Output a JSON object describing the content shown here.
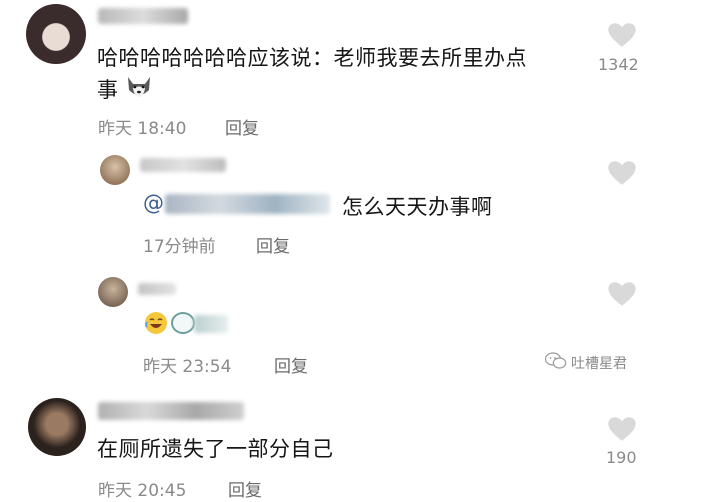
{
  "comments": [
    {
      "text_line1": "哈哈哈哈哈哈哈应该说：老师我要去所里办点",
      "text_line2": "事",
      "time": "昨天 18:40",
      "reply_label": "回复",
      "like_count": "1342"
    },
    {
      "mention_prefix": "@",
      "text": "怎么天天办事啊",
      "time": "17分钟前",
      "reply_label": "回复"
    },
    {
      "time": "昨天 23:54",
      "reply_label": "回复"
    },
    {
      "text": "在厕所遗失了一部分自己",
      "time": "昨天 20:45",
      "reply_label": "回复",
      "like_count": "190"
    }
  ],
  "watermark": {
    "text": "吐槽星君"
  },
  "icons": {
    "heart": "heart-icon",
    "husky": "husky-emoji-icon",
    "laugh": "laughing-emoji-icon",
    "wechat": "wechat-logo-icon"
  }
}
